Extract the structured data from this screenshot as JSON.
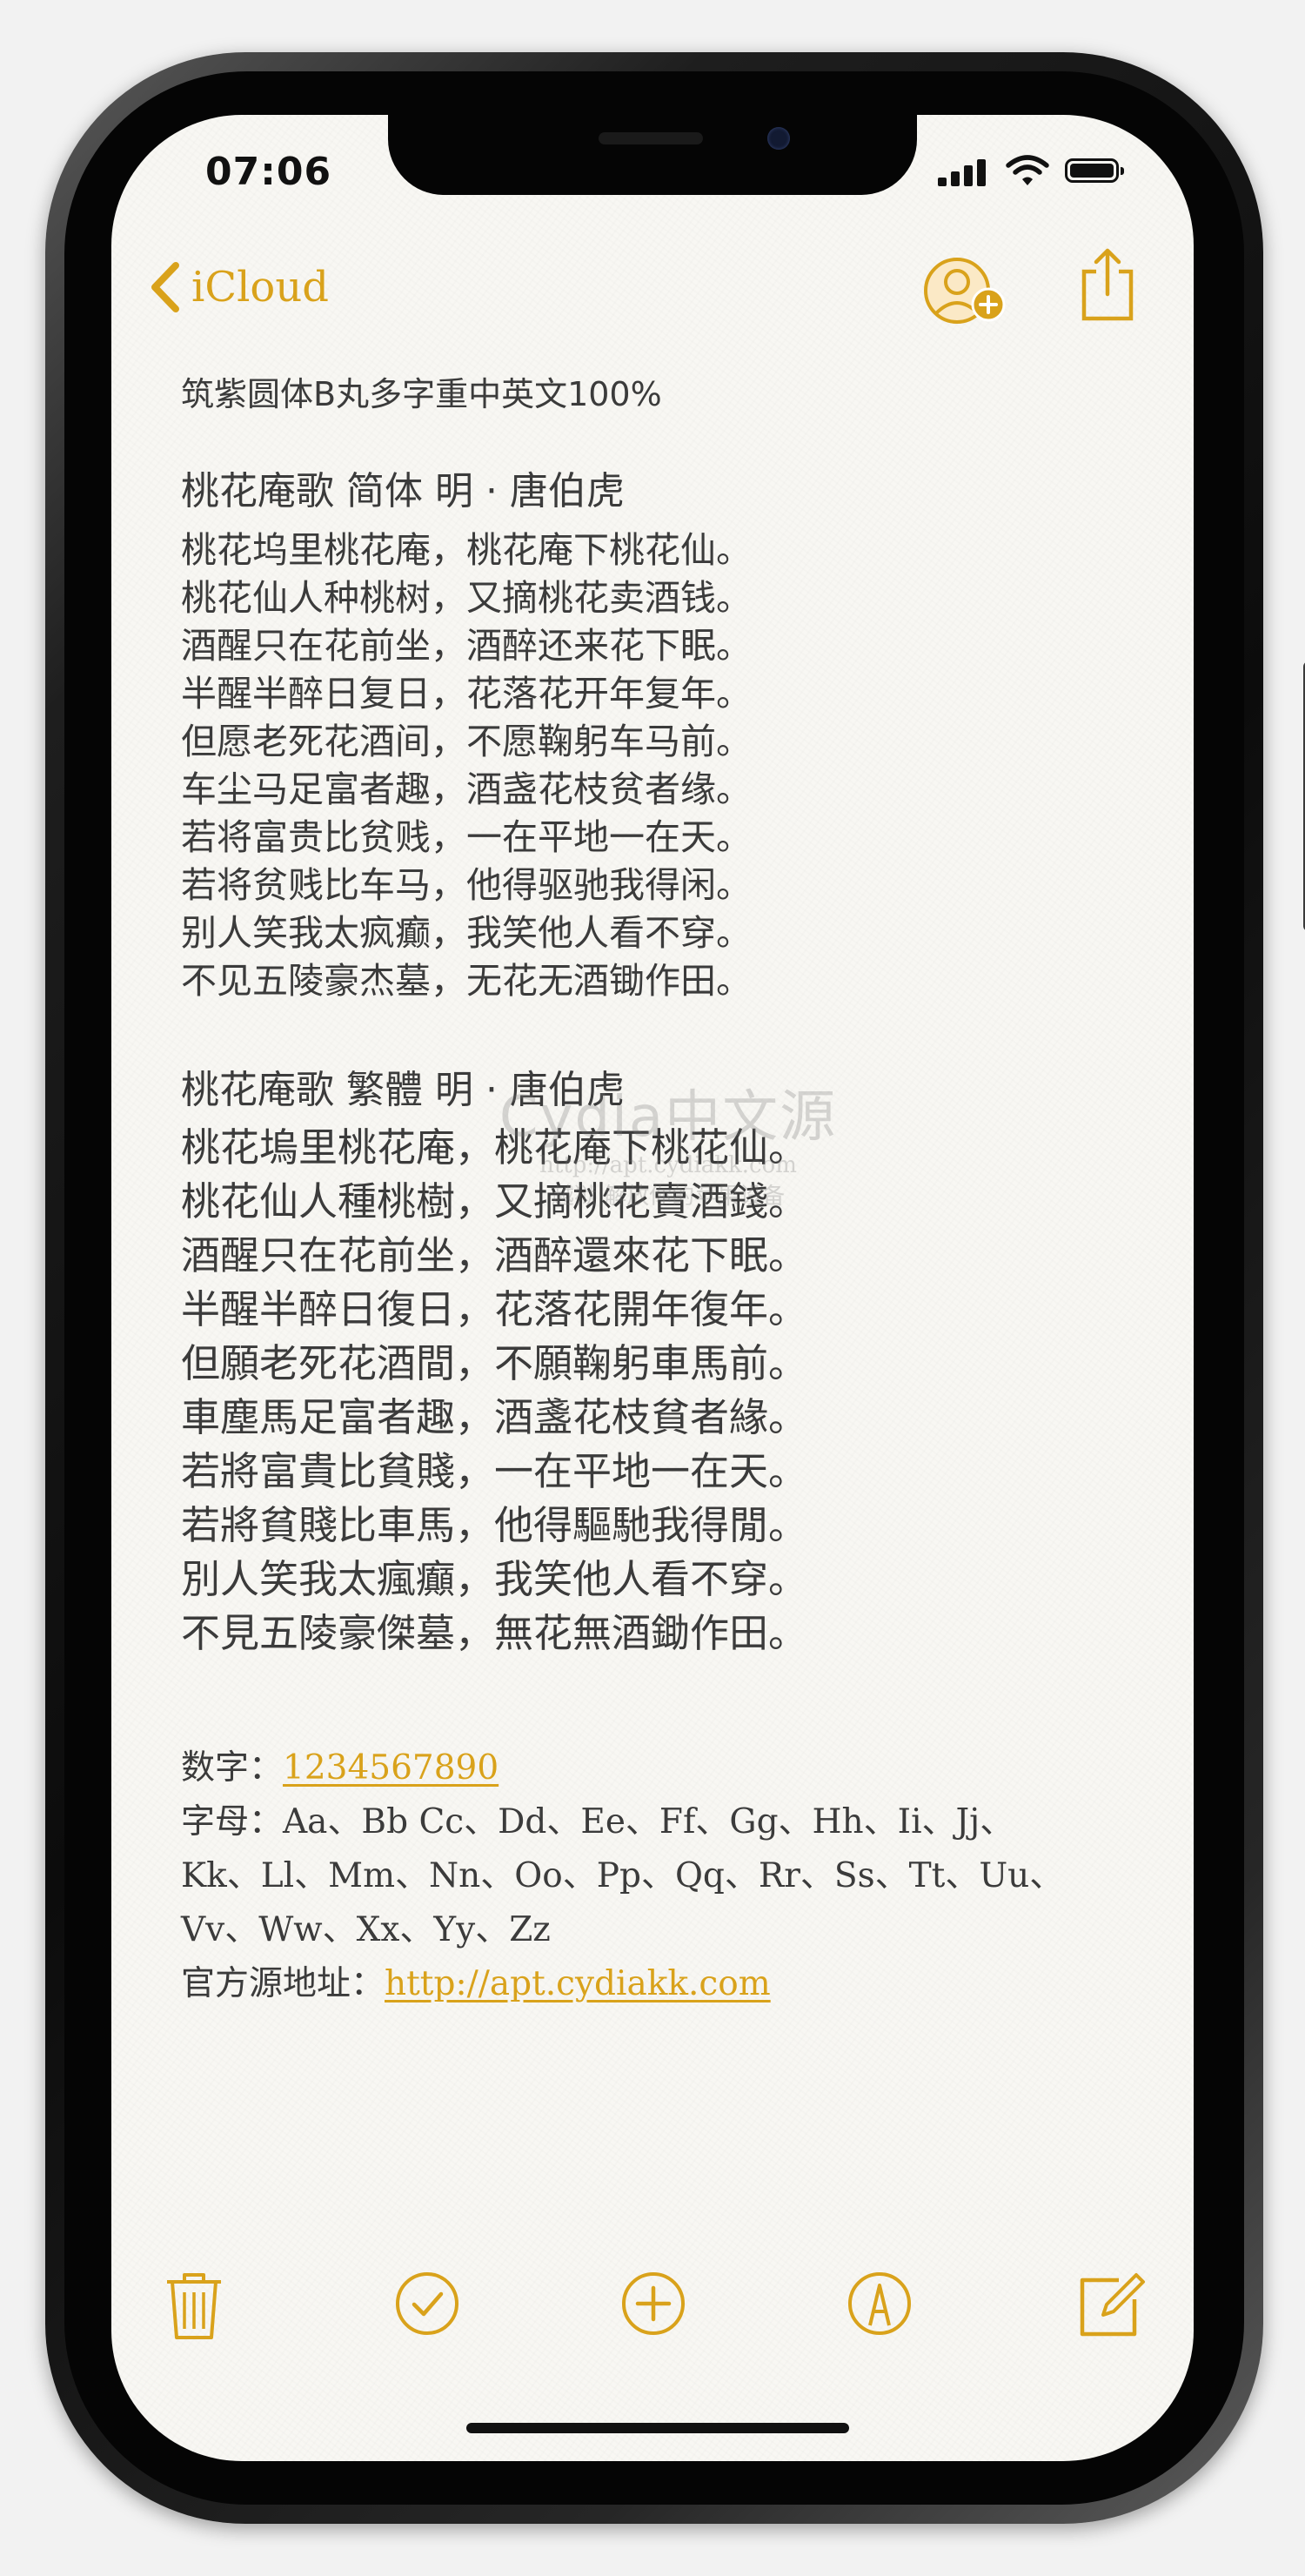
{
  "status_bar": {
    "time": "07:06"
  },
  "nav": {
    "back_label": "iCloud",
    "icons": [
      "chevron-left-icon",
      "add-person-icon",
      "share-icon"
    ]
  },
  "note": {
    "heading": "筑紫圆体B丸多字重中英文100%",
    "poem_simplified": {
      "title": "桃花庵歌  简体   明 · 唐伯虎",
      "lines": [
        "桃花坞里桃花庵，桃花庵下桃花仙。",
        "桃花仙人种桃树，又摘桃花卖酒钱。",
        "酒醒只在花前坐，酒醉还来花下眠。",
        "半醒半醉日复日，花落花开年复年。",
        "但愿老死花酒间，不愿鞠躬车马前。",
        "车尘马足富者趣，酒盏花枝贫者缘。",
        "若将富贵比贫贱，一在平地一在天。",
        "若将贫贱比车马，他得驱驰我得闲。",
        "别人笑我太疯癫，我笑他人看不穿。",
        "不见五陵豪杰墓，无花无酒锄作田。"
      ]
    },
    "poem_traditional": {
      "title": "桃花庵歌  繁體     明 · 唐伯虎",
      "lines": [
        "桃花塢里桃花庵，桃花庵下桃花仙。",
        "桃花仙人種桃樹，又摘桃花賣酒錢。",
        "酒醒只在花前坐，酒醉還來花下眠。",
        "半醒半醉日復日，花落花開年復年。",
        "但願老死花酒間，不願鞠躬車馬前。",
        "車塵馬足富者趣，酒盞花枝貧者緣。",
        "若將富貴比貧賤，一在平地一在天。",
        "若將貧賤比車馬，他得驅馳我得閒。",
        "別人笑我太瘋癲，我笑他人看不穿。",
        "不見五陵豪傑墓，無花無酒鋤作田。"
      ]
    },
    "digits_label": "数字：",
    "digits_value": "1234567890",
    "letters_label": "字母：",
    "letters_lines": [
      "Aa、Bb Cc、Dd、Ee、Ff、Gg、Hh、Ii、Jj、",
      "Kk、Ll、Mm、Nn、Oo、Pp、Qq、Rr、Ss、Tt、Uu、",
      "Vv、Ww、Xx、Yy、Zz"
    ],
    "source_label": "官方源地址：",
    "source_url": "http://apt.cydiakk.com"
  },
  "watermark": {
    "main": "Cydia中文源",
    "url": "http://apt.cydiakk.com",
    "tagline": "越狱  解放你的苹果设备"
  },
  "toolbar": {
    "icons": [
      "trash-icon",
      "checklist-icon",
      "add-icon",
      "markup-icon",
      "compose-icon"
    ]
  },
  "colors": {
    "accent": "#d9a21b",
    "text": "#3b3b3b",
    "paper": "#f8f7f3"
  }
}
